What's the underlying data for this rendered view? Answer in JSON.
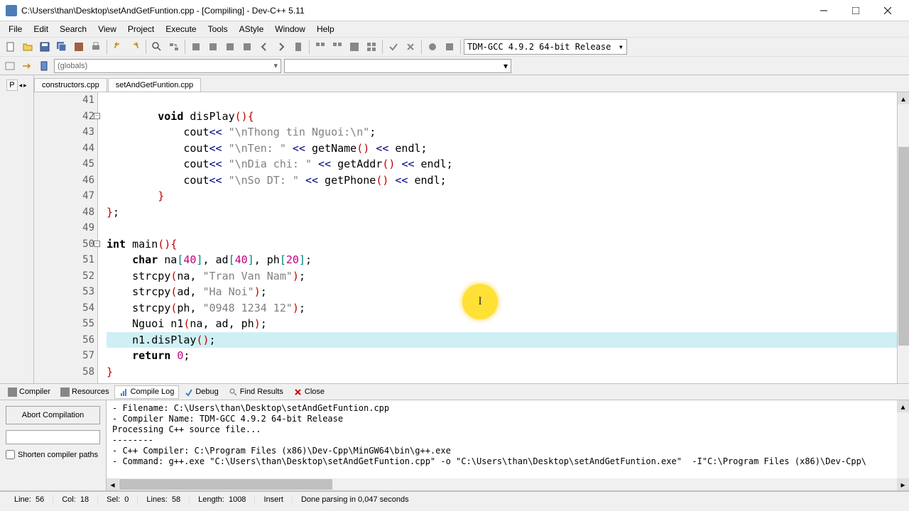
{
  "window": {
    "title": "C:\\Users\\than\\Desktop\\setAndGetFuntion.cpp - [Compiling] - Dev-C++ 5.11"
  },
  "menu": {
    "file": "File",
    "edit": "Edit",
    "search": "Search",
    "view": "View",
    "project": "Project",
    "execute": "Execute",
    "tools": "Tools",
    "astyle": "AStyle",
    "window": "Window",
    "help": "Help"
  },
  "toolbar": {
    "compiler_select": "TDM-GCC 4.9.2 64-bit Release",
    "globals": "(globals)"
  },
  "left_panel": {
    "tab": "P"
  },
  "tabs": {
    "tab1": "constructors.cpp",
    "tab2": "setAndGetFuntion.cpp"
  },
  "code": {
    "lines": [
      {
        "num": "41",
        "html": ""
      },
      {
        "num": "42",
        "fold": "-",
        "html": "        <span class='kw'>void</span> disPlay<span class='paren'>()</span><span class='brace'>{</span>"
      },
      {
        "num": "43",
        "html": "            cout<span class='op'>&lt;&lt;</span> <span class='str'>\"\\nThong tin Nguoi:\\n\"</span>;"
      },
      {
        "num": "44",
        "html": "            cout<span class='op'>&lt;&lt;</span> <span class='str'>\"\\nTen: \"</span> <span class='op'>&lt;&lt;</span> getName<span class='paren'>()</span> <span class='op'>&lt;&lt;</span> endl;"
      },
      {
        "num": "45",
        "html": "            cout<span class='op'>&lt;&lt;</span> <span class='str'>\"\\nDia chi: \"</span> <span class='op'>&lt;&lt;</span> getAddr<span class='paren'>()</span> <span class='op'>&lt;&lt;</span> endl;"
      },
      {
        "num": "46",
        "html": "            cout<span class='op'>&lt;&lt;</span> <span class='str'>\"\\nSo DT: \"</span> <span class='op'>&lt;&lt;</span> getPhone<span class='paren'>()</span> <span class='op'>&lt;&lt;</span> endl;"
      },
      {
        "num": "47",
        "html": "        <span class='brace'>}</span>"
      },
      {
        "num": "48",
        "html": "<span class='brace'>}</span>;"
      },
      {
        "num": "49",
        "html": ""
      },
      {
        "num": "50",
        "fold": "-",
        "html": "<span class='kw'>int</span> main<span class='paren'>()</span><span class='brace'>{</span>"
      },
      {
        "num": "51",
        "html": "    <span class='kw'>char</span> na<span class='bracket'>[</span><span class='num'>40</span><span class='bracket'>]</span>, ad<span class='bracket'>[</span><span class='num'>40</span><span class='bracket'>]</span>, ph<span class='bracket'>[</span><span class='num'>20</span><span class='bracket'>]</span>;"
      },
      {
        "num": "52",
        "html": "    strcpy<span class='paren'>(</span>na, <span class='str'>\"Tran Van Nam\"</span><span class='paren'>)</span>;"
      },
      {
        "num": "53",
        "html": "    strcpy<span class='paren'>(</span>ad, <span class='str'>\"Ha Noi\"</span><span class='paren'>)</span>;"
      },
      {
        "num": "54",
        "html": "    strcpy<span class='paren'>(</span>ph, <span class='str'>\"0948 1234 12\"</span><span class='paren'>)</span>;"
      },
      {
        "num": "55",
        "html": "    Nguoi n1<span class='paren'>(</span>na, ad, ph<span class='paren'>)</span>;"
      },
      {
        "num": "56",
        "html": "    n1.disPlay<span class='paren'>()</span>;",
        "highlighted": true
      },
      {
        "num": "57",
        "html": "    <span class='kw'>return</span> <span class='num'>0</span>;"
      },
      {
        "num": "58",
        "html": "<span class='brace'>}</span>"
      }
    ]
  },
  "bottom_tabs": {
    "compiler": "Compiler",
    "resources": "Resources",
    "compile_log": "Compile Log",
    "debug": "Debug",
    "find_results": "Find Results",
    "close": "Close"
  },
  "compile_panel": {
    "abort": "Abort Compilation",
    "shorten": "Shorten compiler paths",
    "log": [
      "- Filename: C:\\Users\\than\\Desktop\\setAndGetFuntion.cpp",
      "- Compiler Name: TDM-GCC 4.9.2 64-bit Release",
      "",
      "Processing C++ source file...",
      "--------",
      "- C++ Compiler: C:\\Program Files (x86)\\Dev-Cpp\\MinGW64\\bin\\g++.exe",
      "- Command: g++.exe \"C:\\Users\\than\\Desktop\\setAndGetFuntion.cpp\" -o \"C:\\Users\\than\\Desktop\\setAndGetFuntion.exe\"  -I\"C:\\Program Files (x86)\\Dev-Cpp\\"
    ]
  },
  "status": {
    "line_label": "Line:",
    "line": "56",
    "col_label": "Col:",
    "col": "18",
    "sel_label": "Sel:",
    "sel": "0",
    "lines_label": "Lines:",
    "lines": "58",
    "length_label": "Length:",
    "length": "1008",
    "mode": "Insert",
    "msg": "Done parsing in 0,047 seconds"
  }
}
